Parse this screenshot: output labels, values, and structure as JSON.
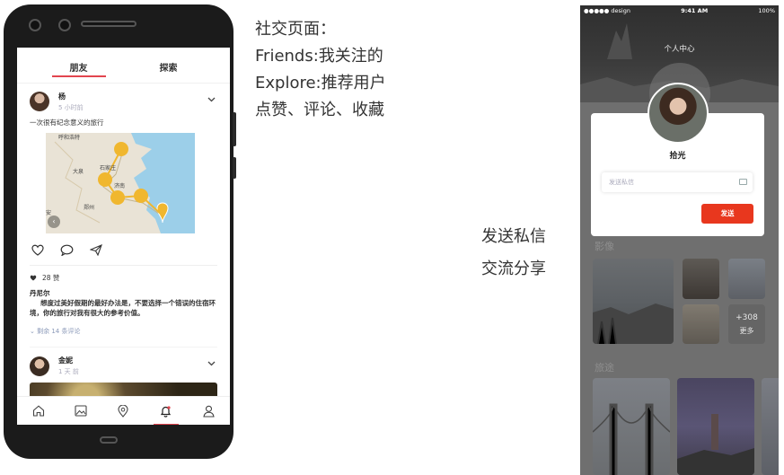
{
  "left_phone": {
    "tabs": [
      {
        "label": "朋友",
        "active": true
      },
      {
        "label": "探索",
        "active": false
      }
    ],
    "post1": {
      "user": "杨",
      "time": "5 小时前",
      "text": "一次很有纪念意义的旅行",
      "map_labels": [
        "呼和浩特",
        "大泉",
        "石家庄",
        "济南",
        "郑州",
        "安"
      ],
      "likes": "28 赞",
      "comment_user": "丹尼尔",
      "comment_text": "想度过美好假期的最好办法是，不要选择一个错误的住宿环境，你的旅行对我有很大的参考价值。",
      "more_comments": "剩余 14 条评论"
    },
    "post2": {
      "user": "金妮",
      "time": "1 天 前"
    },
    "nav_icons": [
      "home-icon",
      "image-icon",
      "location-icon",
      "bell-icon",
      "person-icon"
    ],
    "accent_color": "#e2454f"
  },
  "description": {
    "title": "社交页面：",
    "lines": [
      "Friends:我关注的",
      "Explore:推荐用户",
      "点赞、评论、收藏"
    ],
    "lines2": [
      "发送私信",
      "交流分享"
    ]
  },
  "right_phone": {
    "status": {
      "carrier": "●●●●● design",
      "time": "9:41 AM",
      "battery": "100%"
    },
    "header_title": "个人中心",
    "name": "拾光",
    "message_placeholder": "发送私信",
    "send_label": "发送",
    "send_color": "#e8371e",
    "section_photos": "影像",
    "more_count": "+308",
    "more_label": "更多",
    "section_travel": "旅途"
  }
}
